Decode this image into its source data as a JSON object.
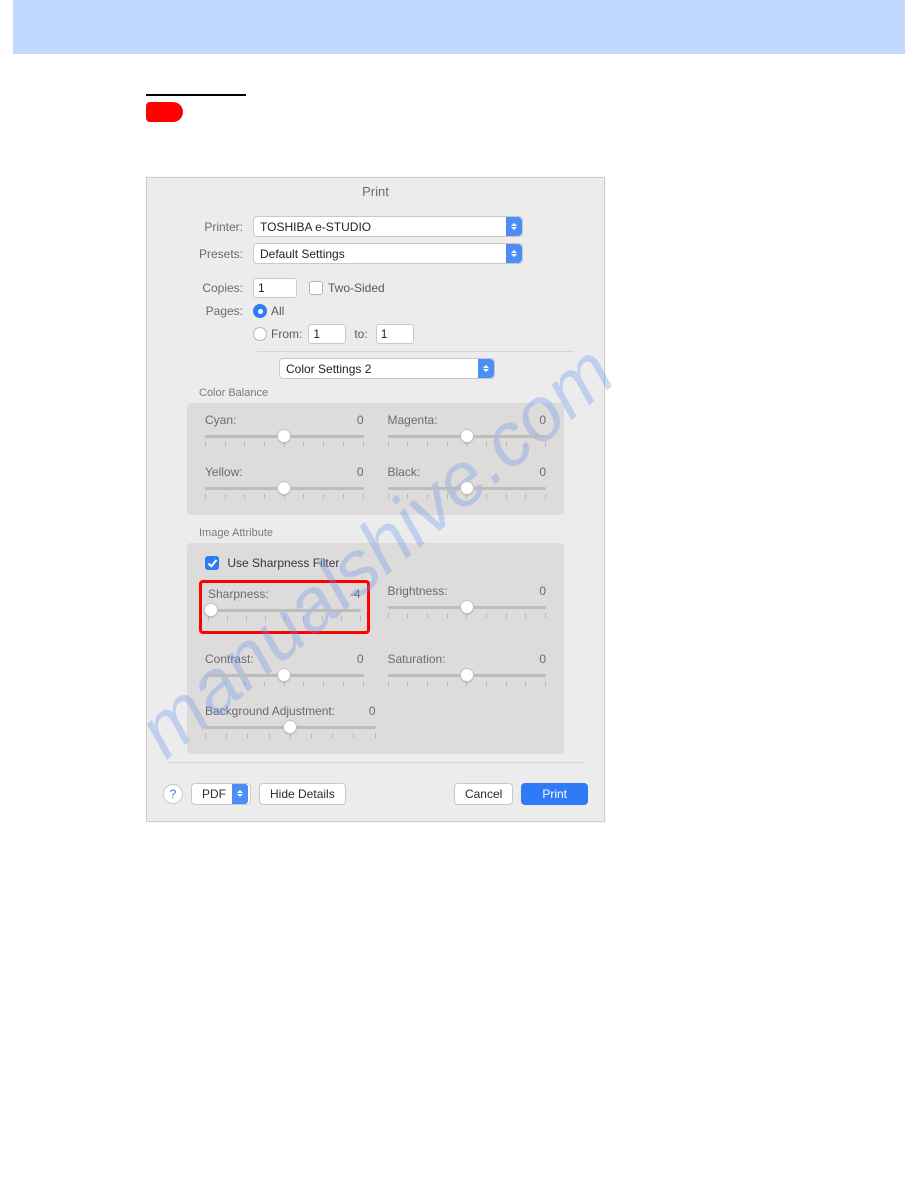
{
  "watermark_text": "manualshive.com",
  "dialog": {
    "title": "Print",
    "printer": {
      "label": "Printer:",
      "value": "TOSHIBA e-STUDIO"
    },
    "presets": {
      "label": "Presets:",
      "value": "Default Settings"
    },
    "copies": {
      "label": "Copies:",
      "value": "1",
      "two_sided_label": "Two-Sided",
      "two_sided_checked": false
    },
    "pages": {
      "label": "Pages:",
      "all_label": "All",
      "from_label": "From:",
      "from_value": "1",
      "to_label": "to:",
      "to_value": "1"
    },
    "section_value": "Color Settings 2",
    "color_balance": {
      "heading": "Color Balance",
      "cyan": {
        "label": "Cyan:",
        "value": "0"
      },
      "magenta": {
        "label": "Magenta:",
        "value": "0"
      },
      "yellow": {
        "label": "Yellow:",
        "value": "0"
      },
      "black": {
        "label": "Black:",
        "value": "0"
      }
    },
    "image_attribute": {
      "heading": "Image Attribute",
      "use_sharpness_label": "Use Sharpness Filter",
      "use_sharpness_checked": true,
      "sharpness": {
        "label": "Sharpness:",
        "value": "-4"
      },
      "brightness": {
        "label": "Brightness:",
        "value": "0"
      },
      "contrast": {
        "label": "Contrast:",
        "value": "0"
      },
      "saturation": {
        "label": "Saturation:",
        "value": "0"
      },
      "background": {
        "label": "Background Adjustment:",
        "value": "0"
      }
    },
    "footer": {
      "pdf_label": "PDF",
      "hide_label": "Hide Details",
      "cancel_label": "Cancel",
      "print_label": "Print"
    }
  }
}
